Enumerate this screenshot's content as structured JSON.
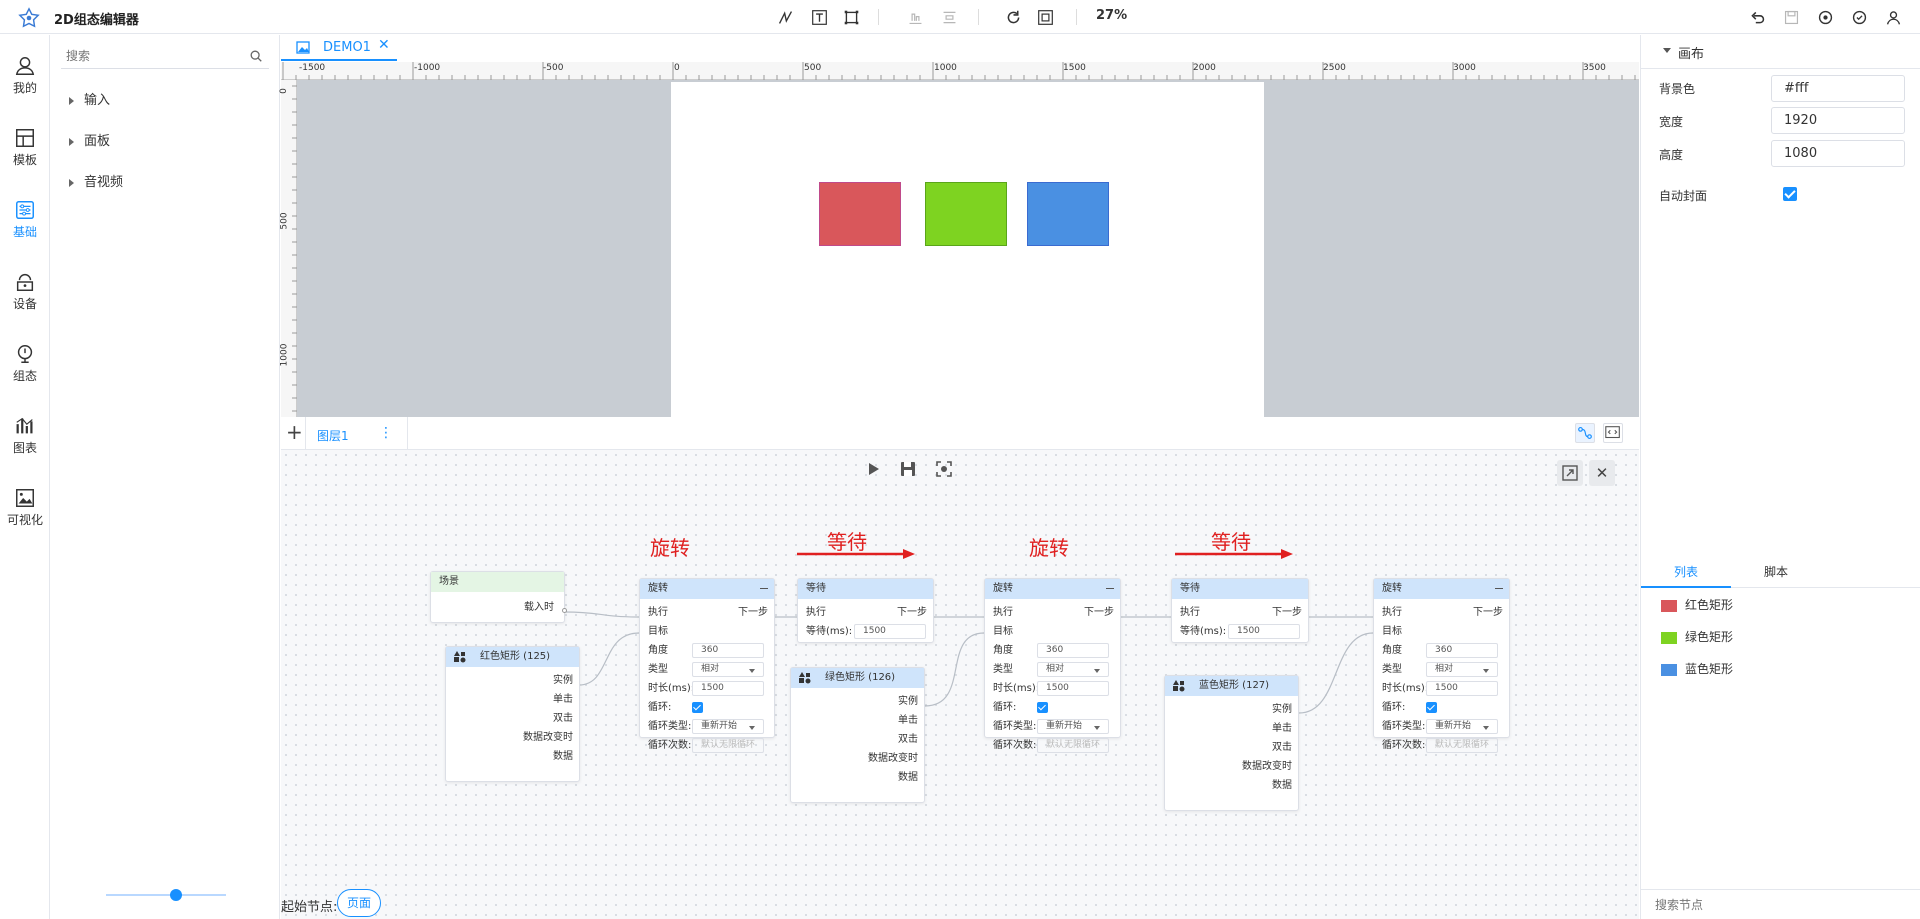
{
  "app": {
    "title": "2D组态编辑器",
    "zoom": "27%"
  },
  "leftnav": {
    "items": [
      {
        "label": "我的",
        "icon": "user-icon"
      },
      {
        "label": "模板",
        "icon": "template-icon"
      },
      {
        "label": "基础",
        "icon": "sliders-icon",
        "active": true
      },
      {
        "label": "设备",
        "icon": "device-icon"
      },
      {
        "label": "组态",
        "icon": "config-icon"
      },
      {
        "label": "图表",
        "icon": "chart-icon"
      },
      {
        "label": "可视化",
        "icon": "visualization-icon"
      }
    ]
  },
  "panel": {
    "search_placeholder": "搜索",
    "tree": [
      {
        "label": "输入"
      },
      {
        "label": "面板"
      },
      {
        "label": "音视频"
      }
    ]
  },
  "tabs": [
    {
      "label": "DEMO1"
    }
  ],
  "ruler": {
    "top": [
      "-1500",
      "-1000",
      "-500",
      "0",
      "500",
      "1000",
      "1500",
      "2000",
      "2500",
      "3000",
      "3500"
    ],
    "left": [
      "0",
      "500",
      "1000"
    ]
  },
  "canvas": {
    "shapes": [
      {
        "name": "红色矩形",
        "color": "#d9575b"
      },
      {
        "name": "绿色矩形",
        "color": "#7ed321"
      },
      {
        "name": "蓝色矩形",
        "color": "#4a90e2"
      }
    ]
  },
  "layer": {
    "name": "图层1"
  },
  "flow": {
    "start_label": "起始节点:",
    "start_value": "页面",
    "annotations": [
      "旋转",
      "等待",
      "旋转",
      "等待"
    ],
    "scene": {
      "title": "场景",
      "port": "载入时"
    },
    "shape_nodes": [
      {
        "title": "红色矩形 (125)"
      },
      {
        "title": "绿色矩形 (126)"
      },
      {
        "title": "蓝色矩形 (127)"
      }
    ],
    "shape_ports": [
      "实例",
      "单击",
      "双击",
      "数据改变时",
      "数据"
    ],
    "rotate": {
      "title": "旋转",
      "exec": "执行",
      "next": "下一步",
      "target": "目标",
      "angle_label": "角度",
      "angle": "360",
      "type_label": "类型",
      "type": "相对",
      "duration_label": "时长(ms):",
      "duration": "1500",
      "loop_label": "循环:",
      "loop_type_label": "循环类型:",
      "loop_type": "重新开始",
      "loop_count_label": "循环次数:",
      "loop_count_placeholder": "默认无限循环"
    },
    "wait": {
      "title": "等待",
      "exec": "执行",
      "next": "下一步",
      "wait_label": "等待(ms):",
      "wait": "1500"
    }
  },
  "rightpanel": {
    "section": "画布",
    "bg_label": "背景色",
    "bg_value": "#fff",
    "width_label": "宽度",
    "width_value": "1920",
    "height_label": "高度",
    "height_value": "1080",
    "cover_label": "自动封面",
    "tabs": [
      "列表",
      "脚本"
    ],
    "list": [
      {
        "name": "红色矩形",
        "color": "#d9575b"
      },
      {
        "name": "绿色矩形",
        "color": "#7ed321"
      },
      {
        "name": "蓝色矩形",
        "color": "#4a90e2"
      }
    ],
    "search_placeholder": "搜索节点"
  }
}
